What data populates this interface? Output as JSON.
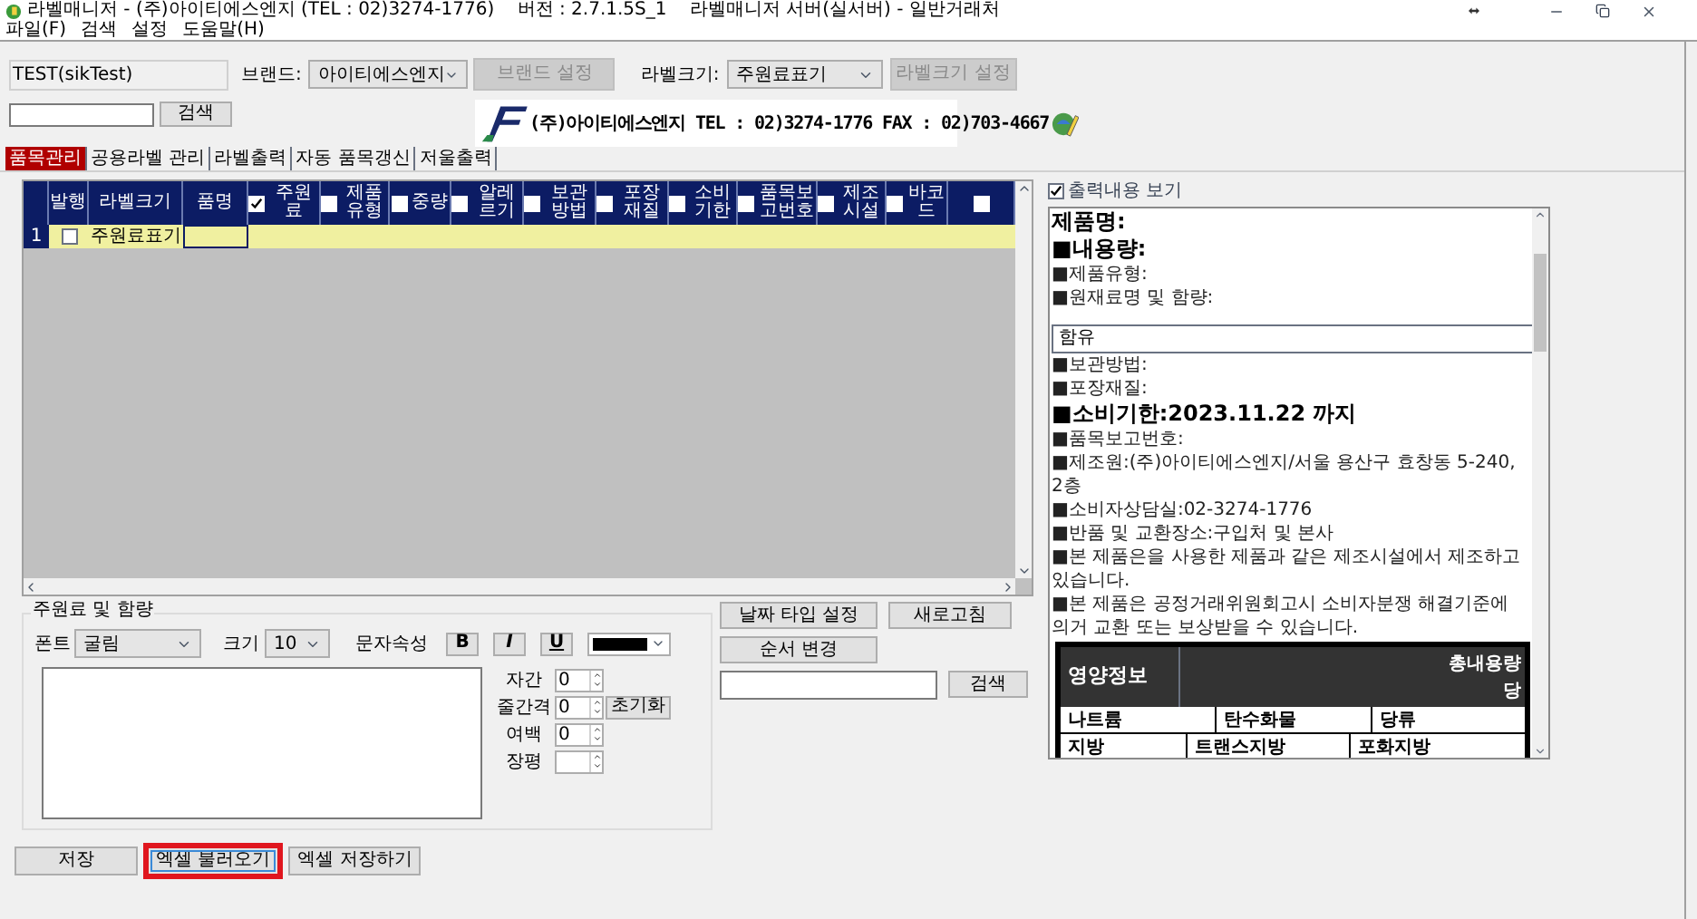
{
  "window": {
    "title": "라벨매니저 - (주)아이티에스엔지 (TEL : 02)3274-1776)    버전 : 2.7.1.5S_1    라벨매니저 서버(실서버) - 일반거래처"
  },
  "menu": [
    "파일(F)",
    "검색",
    "설정",
    "도움말(H)"
  ],
  "toolbar": {
    "user": "TEST(sikTest)",
    "brand_label": "브랜드:",
    "brand_value": "아이티에스엔지",
    "brand_button": {
      "label": "브랜드 설정",
      "disabled": true
    },
    "size_label": "라벨크기:",
    "size_value": "주원료표기",
    "size_button": {
      "label": "라벨크기 설정",
      "disabled": true
    }
  },
  "search": {
    "button": "검색"
  },
  "banner": {
    "text": "(주)아이티에스엔지 TEL : 02)3274-1776 FAX : 02)703-4667"
  },
  "tabs": [
    {
      "label": "품목관리",
      "selected": true
    },
    {
      "label": "공용라벨 관리",
      "selected": false
    },
    {
      "label": "라벨출력",
      "selected": false
    },
    {
      "label": "자동 품목갱신",
      "selected": false
    },
    {
      "label": "저울출력",
      "selected": false
    }
  ],
  "grid": {
    "columns": [
      {
        "kind": "plain",
        "label": "발행"
      },
      {
        "kind": "plain",
        "label": "라벨크기"
      },
      {
        "kind": "plain",
        "label": "품명"
      },
      {
        "kind": "check",
        "label": "주원료",
        "checked": true
      },
      {
        "kind": "check",
        "label": "제품유형",
        "checked": false
      },
      {
        "kind": "check",
        "label": "중량",
        "checked": false
      },
      {
        "kind": "check",
        "label": "알레르기",
        "checked": false
      },
      {
        "kind": "check",
        "label": "보관방법",
        "checked": false
      },
      {
        "kind": "check",
        "label": "포장재질",
        "checked": false
      },
      {
        "kind": "check",
        "label": "소비기한",
        "checked": false
      },
      {
        "kind": "check",
        "label": "품목보고번호",
        "checked": false
      },
      {
        "kind": "check",
        "label": "제조시설",
        "checked": false
      },
      {
        "kind": "check",
        "label": "바코드",
        "checked": false
      },
      {
        "kind": "check",
        "checked": false
      }
    ],
    "rows": [
      {
        "number": "1",
        "issued": false,
        "label_size": "주원료표기",
        "selected": true
      }
    ]
  },
  "editor": {
    "group": "주원료 및 함량",
    "font_label": "폰트",
    "font_value": "굴림",
    "size_label": "크기",
    "size_value": "10",
    "attr_label": "문자속성",
    "styles": [
      "B",
      "I",
      "U"
    ],
    "color": "#000000",
    "spacing": [
      {
        "label": "자간",
        "value": "0"
      },
      {
        "label": "줄간격",
        "value": "0"
      },
      {
        "label": "여백",
        "value": "0"
      },
      {
        "label": "장평"
      }
    ],
    "reset": "초기화"
  },
  "actions": {
    "date_type": "날짜 타입 설정",
    "refresh": "새로고침",
    "reorder": "순서 변경",
    "search_button": "검색"
  },
  "bottom_buttons": [
    {
      "label": "저장",
      "highlighted": false
    },
    {
      "label": "엑셀 불러오기",
      "highlighted": true
    },
    {
      "label": "엑셀 저장하기",
      "highlighted": false
    }
  ],
  "preview": {
    "show_label": "출력내용 보기",
    "show_checked": true,
    "lines": [
      {
        "kind": "heading",
        "text": "제품명:"
      },
      {
        "kind": "heading",
        "text": "■내용량:"
      },
      {
        "kind": "normal",
        "text": "■제품유형:"
      },
      {
        "kind": "normal",
        "text": "■원재료명 및 함량:"
      },
      {
        "kind": "boxed",
        "text": "함유"
      },
      {
        "kind": "normal",
        "text": "■보관방법:"
      },
      {
        "kind": "normal",
        "text": "■포장재질:"
      },
      {
        "kind": "heading",
        "text": "■소비기한:2023.11.22 까지"
      },
      {
        "kind": "normal",
        "text": "■품목보고번호:"
      },
      {
        "kind": "normal",
        "text": "■제조원:(주)아이티에스엔지/서울 용산구 효창동 5-240, 2층"
      },
      {
        "kind": "normal",
        "text": "■소비자상담실:02-3274-1776"
      },
      {
        "kind": "normal",
        "text": "■반품 및 교환장소:구입처 및 본사"
      },
      {
        "kind": "normal",
        "text": "■본 제품은을 사용한 제품과 같은 제조시설에서 제조하고 있습니다."
      },
      {
        "kind": "normal",
        "text": "■본 제품은 공정거래위원회고시 소비자분쟁 해결기준에 의거 교환 또는 보상받을 수 있습니다."
      }
    ],
    "nutrition": {
      "title": "영양정보",
      "total": "총내용량",
      "sub": "당",
      "rows": [
        [
          "나트륨",
          "탄수화물",
          "당류"
        ],
        [
          "지방",
          "트랜스지방",
          "포화지방"
        ]
      ]
    }
  }
}
